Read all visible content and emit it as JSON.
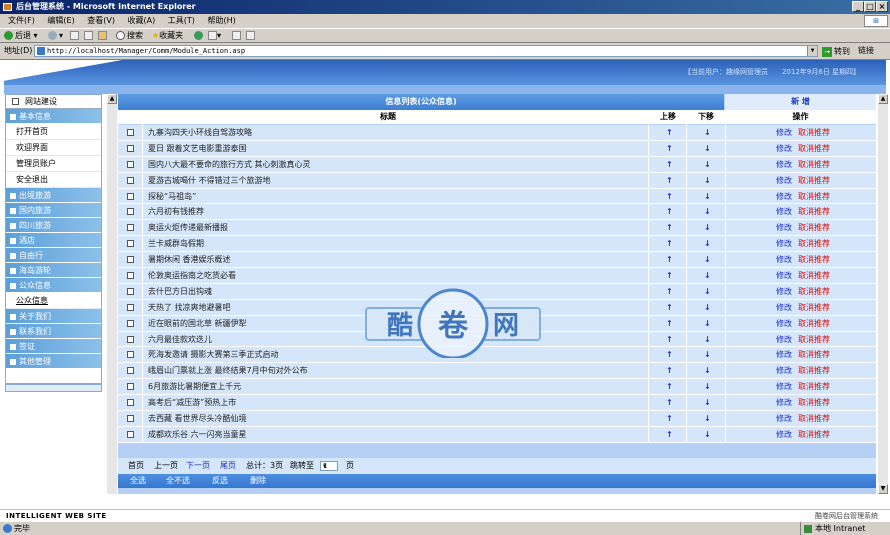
{
  "window": {
    "title": "后台管理系统 - Microsoft Internet Explorer"
  },
  "menu": [
    "文件(F)",
    "编辑(E)",
    "查看(V)",
    "收藏(A)",
    "工具(T)",
    "帮助(H)"
  ],
  "toolbar": {
    "back": "后退",
    "search": "搜索",
    "favorites": "收藏夹"
  },
  "address": {
    "label": "地址(D)",
    "url": "http://localhost/Manager/Comm/Module_Action.asp",
    "go": "转到",
    "links": "链接"
  },
  "header": {
    "user": "【当前用户：趣缘网管理员　　2012年9月6日 星期四】"
  },
  "sidebar": {
    "top": "网站建设",
    "sections": [
      "基本信息"
    ],
    "sub1": [
      "打开首页",
      "欢迎界面",
      "管理员账户",
      "安全退出"
    ],
    "sections2": [
      "出境旅游",
      "国内旅游",
      "四川旅游",
      "酒店",
      "自由行",
      "海岛游轮",
      "公众信息"
    ],
    "sub2": [
      "公众信息"
    ],
    "sections3": [
      "关于我们",
      "联系我们",
      "签证",
      "其他管理"
    ]
  },
  "list": {
    "title": "信息列表(公众信息)",
    "add": "新 增",
    "col_title": "标题",
    "col_up": "上移",
    "col_down": "下移",
    "col_ops": "操作",
    "up_glyph": "↑",
    "down_glyph": "↓",
    "edit": "修改",
    "unrec": "取消推荐",
    "rows": [
      "九寨沟四天小环线自驾游攻略",
      "夏日 跟着文艺电影重游泰国",
      "国内八大最不要命的旅行方式 其心刺激真心灵",
      "夏游古城喝什 不得错过三个旅游地",
      "探秘“马祖岛”",
      "六月初有钱推荐",
      "奥运火炬传递最新播报",
      "兰卡威群岛假期",
      "暑期休闲 香港娱乐概述",
      "伦敦奥运指南之吃货必看",
      "去什巴方日出钩魂",
      "天热了 找凉爽地避暑吧",
      "近在眼前的国北草 新疆伊犁",
      "六月最佳款欢迭儿",
      "死海发邀请 摄影大赛第三季正式启动",
      "峨眉山门票就上涨 最终结果7月中旬对外公布",
      "6月旅游比暑期便宜上千元",
      "高考后“减压游”预热上市",
      "去西藏 看世界尽头冷酷仙境",
      "成都欢乐谷 六一闪亮当童星"
    ]
  },
  "pager": {
    "first": "首页",
    "prev": "上一页",
    "next": "下一页",
    "last": "尾页",
    "total": "总计：3页",
    "jump": "跳转至",
    "page": "1",
    "suffix": "页"
  },
  "actions": {
    "all": "全选",
    "none": "全不选",
    "invert": "反选",
    "delete": "删除"
  },
  "footer": {
    "left": "INTELLIGENT WEB SITE",
    "right": "酷卷网后台管理系统"
  },
  "watermark": {
    "chars": [
      "酷",
      "卷",
      "网"
    ]
  },
  "status": {
    "done": "完毕",
    "zone": "本地 Intranet"
  }
}
